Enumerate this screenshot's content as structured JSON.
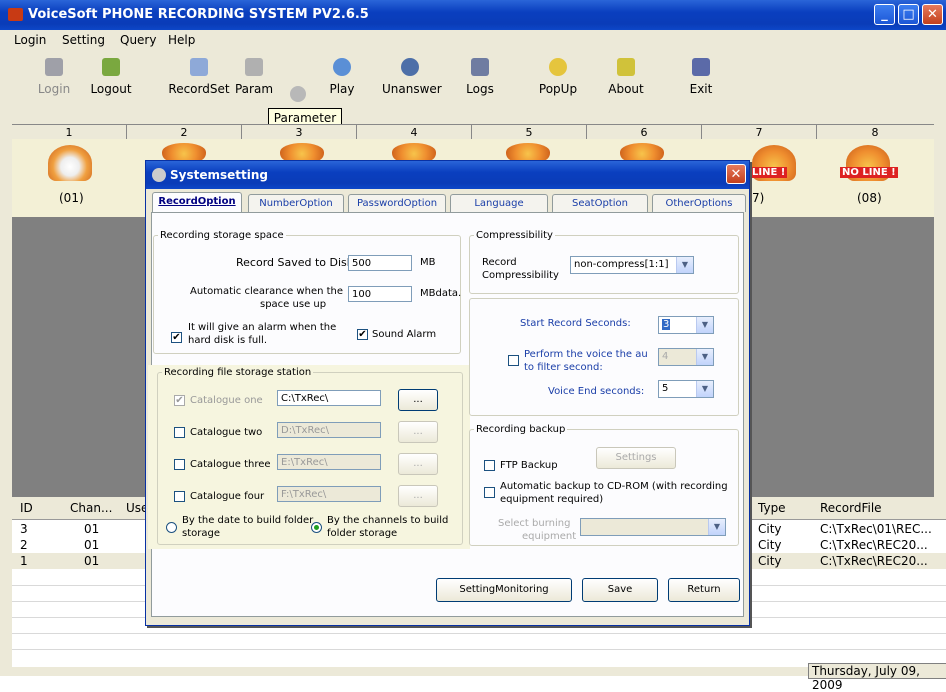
{
  "window": {
    "title": "VoiceSoft PHONE RECORDING SYSTEM PV2.6.5",
    "min": "_",
    "max": "□",
    "close": "✕"
  },
  "menu": [
    "Login",
    "Setting",
    "Query",
    "Help"
  ],
  "toolbar": [
    {
      "label": "Login",
      "icon": "user-icon",
      "disabled": true
    },
    {
      "label": "Logout",
      "icon": "logout-icon"
    },
    {
      "label": "RecordSet",
      "icon": "speaker-icon"
    },
    {
      "label": "Param",
      "icon": "gear-icon"
    },
    {
      "label": "Play",
      "icon": "magnifier-icon"
    },
    {
      "label": "Unanswer",
      "icon": "magnifier-icon"
    },
    {
      "label": "Logs",
      "icon": "notepad-icon"
    },
    {
      "label": "PopUp",
      "icon": "smiley-icon"
    },
    {
      "label": "About",
      "icon": "star-icon"
    },
    {
      "label": "Exit",
      "icon": "exit-icon"
    }
  ],
  "tooltip": "Parameter",
  "channels": [
    {
      "num": "1",
      "label": "(01)"
    },
    {
      "num": "2",
      "label": ""
    },
    {
      "num": "3",
      "label": ""
    },
    {
      "num": "4",
      "label": ""
    },
    {
      "num": "5",
      "label": ""
    },
    {
      "num": "6",
      "label": ""
    },
    {
      "num": "7",
      "label": "7)"
    },
    {
      "num": "8",
      "label": "(08)"
    }
  ],
  "noline_text": "NO LINE !",
  "noline_partial": "LINE !",
  "log": {
    "headers": [
      "ID",
      "Chan...",
      "Use",
      "Type",
      "RecordFile"
    ],
    "rows": [
      [
        "3",
        "01",
        "City",
        "C:\\TxRec\\01\\REC..."
      ],
      [
        "2",
        "01",
        "City",
        "C:\\TxRec\\REC20..."
      ],
      [
        "1",
        "01",
        "City",
        "C:\\TxRec\\REC20..."
      ]
    ]
  },
  "status_date": "Thursday, July 09, 2009",
  "dialog": {
    "title": "Systemsetting",
    "tabs": [
      "RecordOption",
      "NumberOption",
      "PasswordOption",
      "Language",
      "SeatOption",
      "OtherOptions"
    ],
    "storage": {
      "legend": "Recording storage space",
      "save_label": "Record Saved to Disk",
      "save_value": "500",
      "save_unit": "MB",
      "clear_label_1": "Automatic clearance when the",
      "clear_label_2": "space use up",
      "clear_value": "100",
      "clear_unit": "MBdata.",
      "alarm_label_1": "It will give an alarm when the",
      "alarm_label_2": "hard disk is full.",
      "sound_alarm": "Sound Alarm"
    },
    "station": {
      "legend": "Recording file storage station",
      "catalogues": [
        {
          "label": "Catalogue one",
          "path": "C:\\TxRec\\",
          "checked": true
        },
        {
          "label": "Catalogue two",
          "path": "D:\\TxRec\\"
        },
        {
          "label": "Catalogue three",
          "path": "E:\\TxRec\\"
        },
        {
          "label": "Catalogue four",
          "path": "F:\\TxRec\\"
        }
      ],
      "browse": "...",
      "radio_date_1": "By the date to build folder",
      "radio_date_2": "storage",
      "radio_chan_1": "By the channels to build",
      "radio_chan_2": "folder storage"
    },
    "compress": {
      "legend": "Compressibility",
      "label_1": "Record",
      "label_2": "Compressibility",
      "value": "non-compress[1:1]"
    },
    "timing": {
      "start_label": "Start Record Seconds:",
      "start_value": "3",
      "filter_label_1": "Perform the voice the au",
      "filter_label_2": "to filter second:",
      "filter_value": "4",
      "end_label": "Voice End seconds:",
      "end_value": "5"
    },
    "backup": {
      "legend": "Recording backup",
      "ftp": "FTP Backup",
      "settings": "Settings",
      "cdrom_1": "Automatic backup to CD-ROM (with recording",
      "cdrom_2": "equipment required)",
      "burn_1": "Select burning",
      "burn_2": "equipment"
    },
    "buttons": {
      "monitoring": "SettingMonitoring",
      "save": "Save",
      "ret": "Return"
    }
  },
  "colors": {
    "titlebar": "#0a3cb8",
    "face": "#ece9d8",
    "highlight": "#f6f5df"
  }
}
